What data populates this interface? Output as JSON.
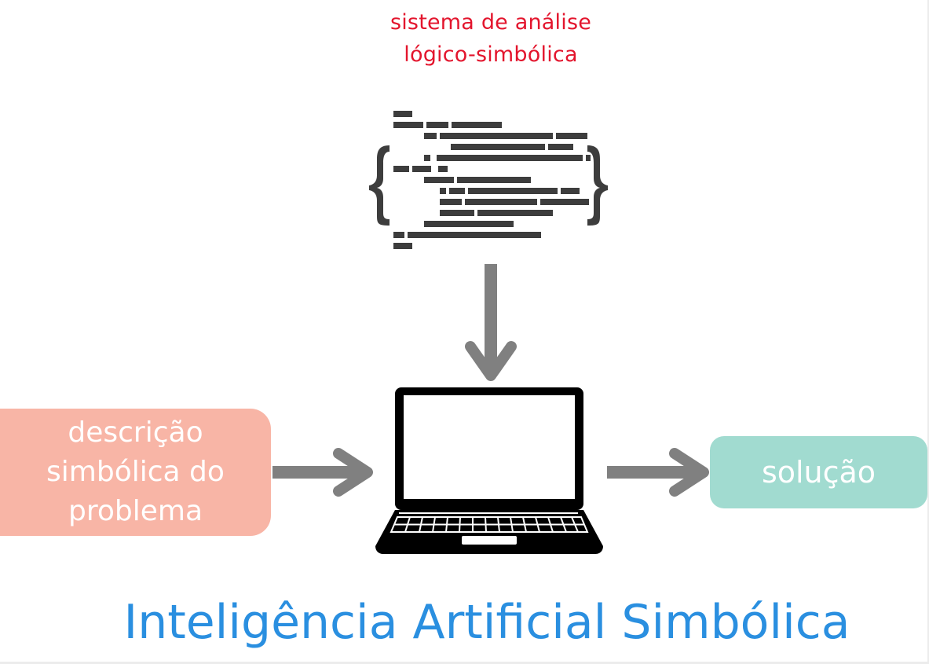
{
  "system": {
    "line1": "sistema de análise",
    "line2": "lógico-simbólica"
  },
  "input": {
    "line1": "descrição",
    "line2": "simbólica do",
    "line3": "problema"
  },
  "output": {
    "label": "solução"
  },
  "title": "Inteligência Artificial Simbólica",
  "colors": {
    "system_text": "#e3152d",
    "input_box": "#f8b5a6",
    "output_box": "#a1dbd0",
    "title": "#2a8fe0",
    "arrow": "#808080",
    "icon": "#3d3d3d"
  },
  "icons": {
    "system": "code-braces-icon",
    "computer": "laptop-icon"
  }
}
